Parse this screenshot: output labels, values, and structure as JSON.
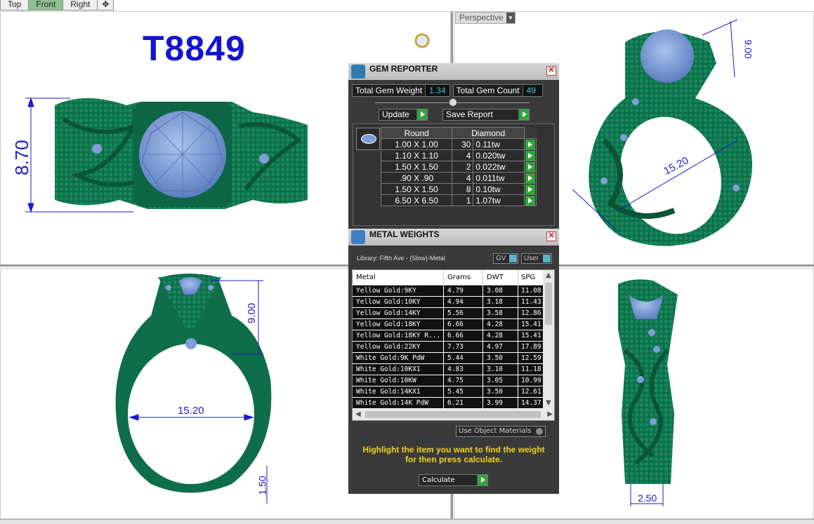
{
  "tabs": [
    {
      "label": "Top",
      "active": false
    },
    {
      "label": "Front",
      "active": true
    },
    {
      "label": "Right",
      "active": false
    }
  ],
  "tab_add_icon": "plus-icon",
  "design_code": "T8849",
  "perspective_label": "Perspective",
  "dimensions": {
    "front_height": "8.70",
    "persp_top": "9.00",
    "persp_diameter": "15.20",
    "right_head_height": "9.00",
    "right_inner_diameter": "15.20",
    "right_band_width": "1.50",
    "side_band_width": "2.50"
  },
  "gem_reporter": {
    "title": "GEM REPORTER",
    "total_weight_label": "Total Gem Weight",
    "total_weight_value": "1.34",
    "total_count_label": "Total Gem Count",
    "total_count_value": "49",
    "update_label": "Update",
    "save_report_label": "Save Report",
    "shape_header": "Round",
    "type_header": "Diamond",
    "rows": [
      {
        "size": "1.00 X 1.00",
        "count": "30",
        "weight": "0.11tw"
      },
      {
        "size": "1.10 X 1.10",
        "count": "4",
        "weight": "0.020tw"
      },
      {
        "size": "1.50 X 1.50",
        "count": "2",
        "weight": "0.022tw"
      },
      {
        "size": ".90 X .90",
        "count": "4",
        "weight": "0.011tw"
      },
      {
        "size": "1.50 X 1.50",
        "count": "8",
        "weight": "0.10tw"
      },
      {
        "size": "6.50 X 6.50",
        "count": "1",
        "weight": "1.07tw"
      }
    ]
  },
  "metal_weights": {
    "title": "METAL WEIGHTS",
    "library_label": "Library: Fifth Ave - (Slow)-Metal",
    "gv_label": "GV",
    "user_label": "User",
    "headers": {
      "metal": "Metal",
      "grams": "Grams",
      "dwt": "DWT",
      "spg": "SPG"
    },
    "rows": [
      {
        "metal": "Yellow Gold:9KY",
        "grams": "4.79",
        "dwt": "3.08",
        "spg": "11.08"
      },
      {
        "metal": "Yellow Gold:10KY",
        "grams": "4.94",
        "dwt": "3.18",
        "spg": "11.43"
      },
      {
        "metal": "Yellow Gold:14KY",
        "grams": "5.56",
        "dwt": "3.58",
        "spg": "12.86"
      },
      {
        "metal": "Yellow Gold:18KY",
        "grams": "6.66",
        "dwt": "4.28",
        "spg": "15.41"
      },
      {
        "metal": "Yellow Gold:18KY R...",
        "grams": "6.66",
        "dwt": "4.28",
        "spg": "15.41"
      },
      {
        "metal": "Yellow Gold:22KY",
        "grams": "7.73",
        "dwt": "4.97",
        "spg": "17.89"
      },
      {
        "metal": "White Gold:9K PdW",
        "grams": "5.44",
        "dwt": "3.50",
        "spg": "12.59"
      },
      {
        "metal": "White Gold:10KX1",
        "grams": "4.83",
        "dwt": "3.10",
        "spg": "11.18"
      },
      {
        "metal": "White Gold:10KW",
        "grams": "4.75",
        "dwt": "3.05",
        "spg": "10.99"
      },
      {
        "metal": "White Gold:14KX1",
        "grams": "5.45",
        "dwt": "3.50",
        "spg": "12.61"
      },
      {
        "metal": "White Gold:14K PdW",
        "grams": "6.21",
        "dwt": "3.99",
        "spg": "14.37"
      }
    ],
    "use_object_materials_label": "Use Object Materials",
    "hint_line1": "Highlight the item you want to find the weight",
    "hint_line2": "for then press calculate.",
    "calculate_label": "Calculate"
  },
  "colors": {
    "metal_green": "#0f6e4a",
    "gem_blue": "#7f9ed6",
    "dimension_blue": "#1a1ad0",
    "value_cyan": "#39c6e8",
    "hint_yellow": "#f2d21c"
  }
}
